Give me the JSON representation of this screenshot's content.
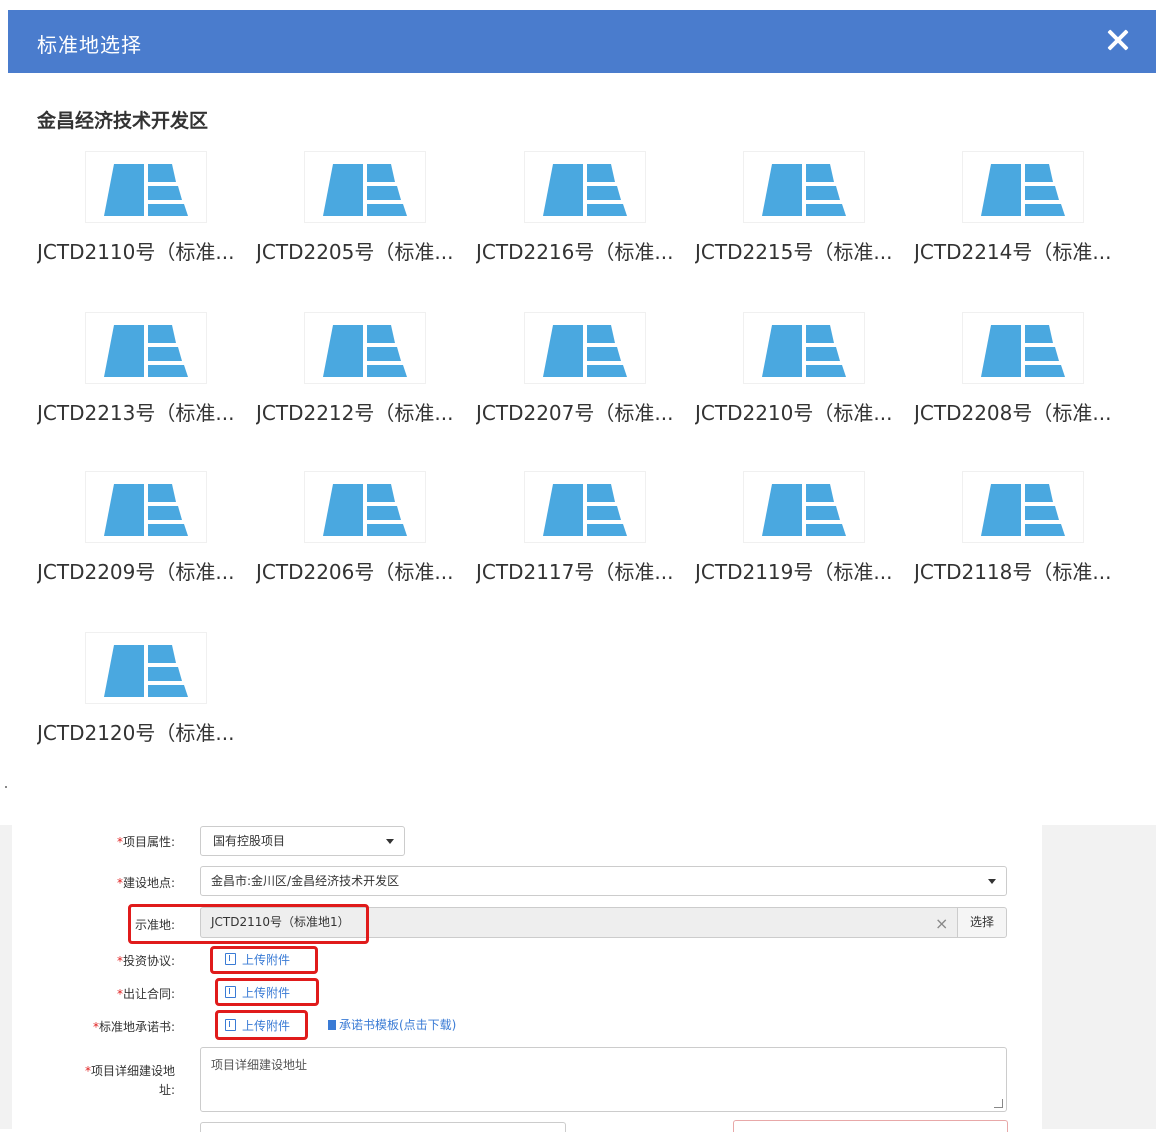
{
  "dialog": {
    "title": "标准地选择",
    "section_title": "金昌经济技术开发区",
    "tiles": [
      {
        "label": "JCTD2110号（标准..."
      },
      {
        "label": "JCTD2205号（标准..."
      },
      {
        "label": "JCTD2216号（标准..."
      },
      {
        "label": "JCTD2215号（标准..."
      },
      {
        "label": "JCTD2214号（标准..."
      },
      {
        "label": "JCTD2213号（标准..."
      },
      {
        "label": "JCTD2212号（标准..."
      },
      {
        "label": "JCTD2207号（标准..."
      },
      {
        "label": "JCTD2210号（标准..."
      },
      {
        "label": "JCTD2208号（标准..."
      },
      {
        "label": "JCTD2209号（标准..."
      },
      {
        "label": "JCTD2206号（标准..."
      },
      {
        "label": "JCTD2117号（标准..."
      },
      {
        "label": "JCTD2119号（标准..."
      },
      {
        "label": "JCTD2118号（标准..."
      },
      {
        "label": "JCTD2120号（标准..."
      }
    ],
    "thumbnail_icon": "land-parcel-icon",
    "thumbnail_color": "#4aa8e0"
  },
  "form": {
    "project_attr": {
      "required": "*",
      "label": "项目属性:",
      "value": "国有控股项目"
    },
    "location": {
      "required": "*",
      "label": "建设地点:",
      "value": "金昌市:金川区/金昌经济技术开发区"
    },
    "standard_land": {
      "label": "示准地:",
      "value": "JCTD2110号（标准地1）",
      "clear": "×",
      "choose": "选择"
    },
    "investment_agreement": {
      "required": "*",
      "label": "投资协议:",
      "upload": "上传附件"
    },
    "transfer_contract": {
      "required": "*",
      "label": "出让合同:",
      "upload": "上传附件"
    },
    "commitment": {
      "required": "*",
      "label": "标准地承诺书:",
      "upload": "上传附件",
      "template_link": "承诺书模板(点击下载)"
    },
    "detail_address": {
      "required": "*",
      "label_line1": "项目详细建设地",
      "label_line2": "址:",
      "placeholder": "项目详细建设地址"
    }
  },
  "colors": {
    "header": "#4a7ccd",
    "link": "#3a7bd5",
    "highlight": "#e01b1b",
    "required": "#e02020"
  }
}
